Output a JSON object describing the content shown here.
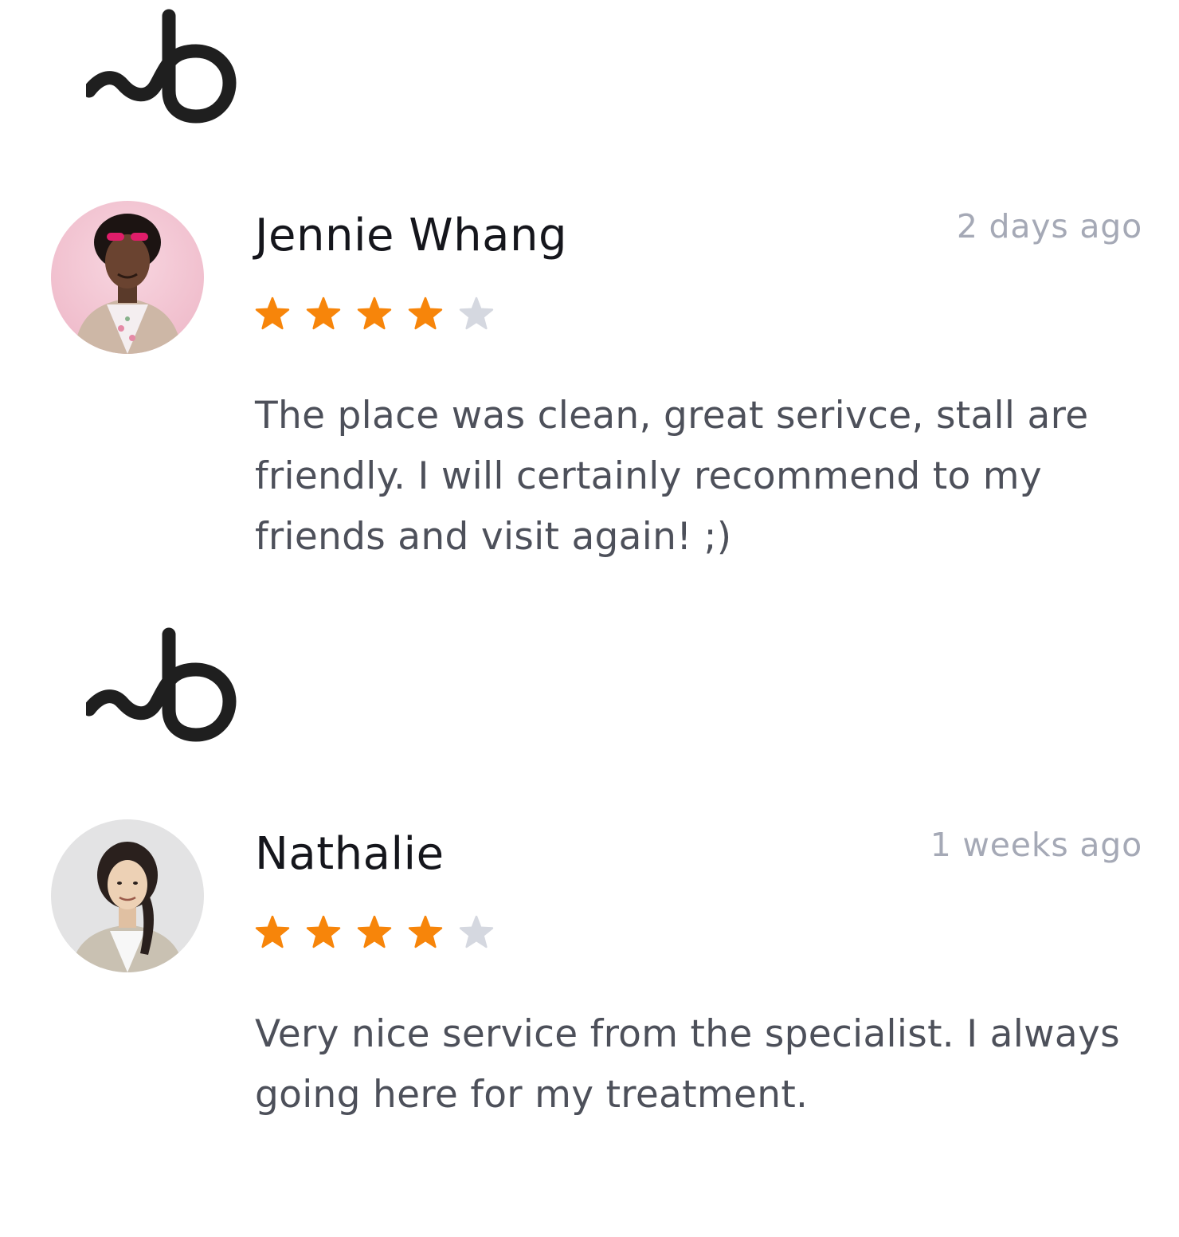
{
  "colors": {
    "star_filled": "#f7850a",
    "star_empty": "#d5d8e0",
    "name": "#15161c",
    "time": "#a5a9b6",
    "text": "#4d505a",
    "logo": "#1f1f1f"
  },
  "reviews": [
    {
      "logo_icon": "brand-logo-icon",
      "avatar_icon": "avatar-photo",
      "name": "Jennie Whang",
      "time": "2 days ago",
      "rating": 4,
      "rating_max": 5,
      "text": "The place was clean, great serivce, stall are friendly. I will certainly recommend to my friends and visit again! ;)"
    },
    {
      "logo_icon": "brand-logo-icon",
      "avatar_icon": "avatar-photo",
      "name": "Nathalie",
      "time": "1 weeks ago",
      "rating": 4,
      "rating_max": 5,
      "text": "Very nice service from the specialist. I always going here for my treatment."
    }
  ]
}
